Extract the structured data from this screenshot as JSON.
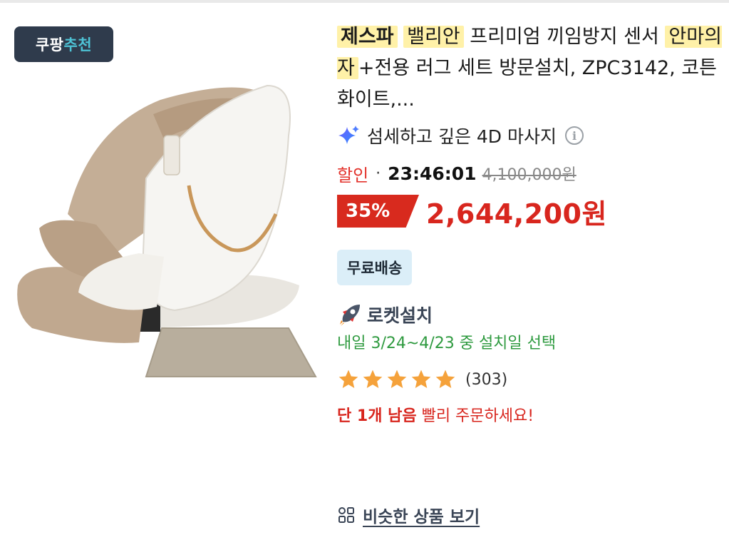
{
  "badge": {
    "word_white": "쿠팡",
    "word_cyan": "추천"
  },
  "product": {
    "title_brand": "제스파",
    "title_model": "밸리안",
    "title_part1": "프리미엄 끼임방지 센서",
    "title_keyword": "안마의자",
    "title_part2": "+전용 러그 세트 방문설치, ZPC3142, 코튼화이트,...",
    "feature": "섬세하고 깊은 4D 마사지",
    "sale_label": "할인",
    "sale_dot": "·",
    "timer": "23:46:01",
    "original_price": "4,100,000원",
    "discount_pct": "35%",
    "price": "2,644,200원",
    "shipping_badge": "무료배송",
    "rocket_label": "로켓설치",
    "delivery": "내일 3/24~4/23 중 설치일 선택",
    "rating_stars": 5,
    "rating_count": "(303)",
    "stock_bold": "단 1개 남음",
    "stock_rest": " 빨리 주문하세요!",
    "similar_link": "비슷한 상품 보기"
  },
  "colors": {
    "sale_red": "#d8261e",
    "badge_bg": "#2f3b4c",
    "badge_cyan": "#4ec3d6",
    "highlight": "#fff1a8",
    "delivery_green": "#2e9a3f",
    "star_orange": "#f5a23b",
    "shipping_bg": "#dbeef8"
  },
  "icons": {
    "feature": "sparkle-icon",
    "info": "info-icon",
    "rocket": "rocket-icon",
    "star": "star-icon",
    "similar": "grid-icon"
  }
}
